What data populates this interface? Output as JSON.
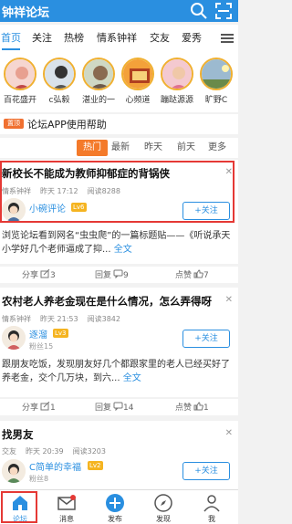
{
  "app": {
    "title": "钟祥论坛"
  },
  "tabs": [
    "首页",
    "关注",
    "热榜",
    "情系钟祥",
    "交友",
    "爱秀"
  ],
  "circles": [
    {
      "label": "百花盛开"
    },
    {
      "label": "c弘毅"
    },
    {
      "label": "湛业的一"
    },
    {
      "label": "心频道"
    },
    {
      "label": "蹦跶源源"
    },
    {
      "label": "旷野C"
    }
  ],
  "notice": {
    "badge": "置顶",
    "text": "论坛APP使用帮助"
  },
  "filters": [
    "热门",
    "最新",
    "昨天",
    "前天",
    "更多"
  ],
  "posts": [
    {
      "title": "新校长不能成为教师抑郁症的背锅侠",
      "source": "情系钟祥",
      "time": "昨天 17:12",
      "views": "阅读8288",
      "author": "小碗评论",
      "level": "Lv6",
      "fans": "",
      "follow": "+关注",
      "excerpt": "浏览论坛看到网名“虫虫爬”的一篇标题贴——《听说承天小学好几个老师逼成了抑...",
      "fulltext": "全文",
      "share": "分享",
      "share_count": "3",
      "reply": "回复",
      "reply_count": "9",
      "like": "点赞",
      "like_count": "7"
    },
    {
      "title": "农村老人养老金现在是什么情况，怎么弄得呀",
      "source": "情系钟祥",
      "time": "昨天 21:53",
      "views": "阅读3842",
      "author": "逐溜",
      "level": "Lv3",
      "fans": "粉丝15",
      "follow": "+关注",
      "excerpt": "跟朋友吃饭，发现朋友好几个都跟家里的老人已经买好了养老金，交个几万块，到六...",
      "fulltext": "全文",
      "share": "分享",
      "share_count": "1",
      "reply": "回复",
      "reply_count": "14",
      "like": "点赞",
      "like_count": "1"
    },
    {
      "title": "找男友",
      "source": "交友",
      "time": "昨天 20:39",
      "views": "阅读3203",
      "author": "C简单的幸福",
      "level": "Lv2",
      "fans": "粉丝8",
      "follow": "+关注"
    }
  ],
  "bottom_nav": [
    "论坛",
    "消息",
    "发布",
    "发现",
    "我"
  ],
  "colors": {
    "brand": "#2a8fe0",
    "accent": "#f47a2a",
    "highlight": "#e53935"
  }
}
